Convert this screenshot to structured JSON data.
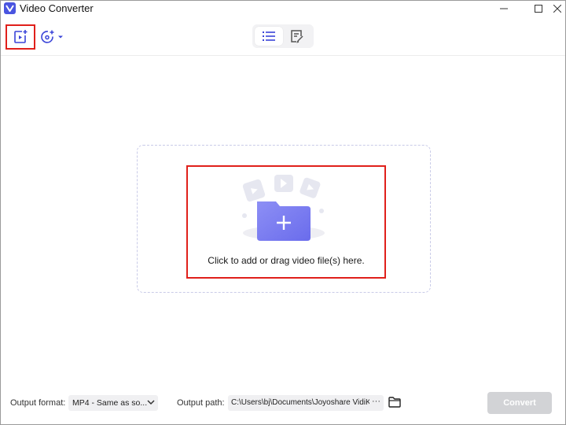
{
  "window": {
    "title": "Video Converter",
    "controls": {
      "minimize": "minimize-icon",
      "maximize": "maximize-icon",
      "close": "close-icon"
    }
  },
  "toolbar": {
    "add_file_icon": "add-video-icon",
    "disc_icon": "add-disc-icon",
    "view_modes": [
      {
        "name": "list-view",
        "icon": "list-icon",
        "active": true
      },
      {
        "name": "task-view",
        "icon": "task-list-icon",
        "active": false
      }
    ]
  },
  "drop_zone": {
    "text": "Click to add or drag video file(s) here.",
    "icon": "folder-plus-icon"
  },
  "bottom_bar": {
    "output_format_label": "Output format:",
    "output_format_value": "MP4 - Same as so...",
    "output_path_label": "Output path:",
    "output_path_value": "C:\\Users\\bj\\Documents\\Joyoshare VidiK",
    "path_more": "···",
    "convert_label": "Convert"
  },
  "colors": {
    "accent": "#4a55e0",
    "highlight_border": "#e0201b",
    "convert_disabled": "#d2d3d6",
    "folder_gradient_start": "#8d8ff5",
    "folder_gradient_end": "#6a6cec"
  }
}
